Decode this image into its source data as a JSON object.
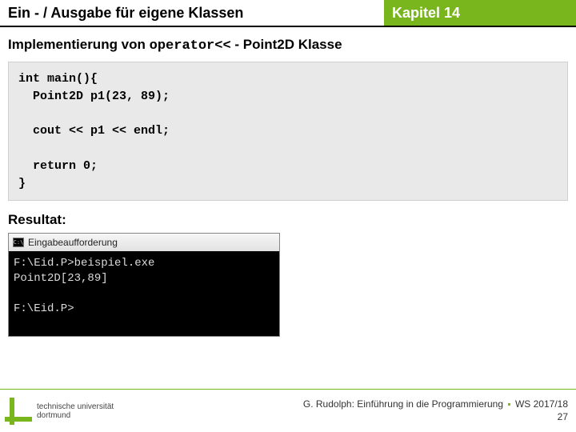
{
  "header": {
    "left": "Ein - / Ausgabe für eigene Klassen",
    "right": "Kapitel 14"
  },
  "subtitle": {
    "prefix": "Implementierung von ",
    "op": "operator<<",
    "suffix": " - Point2D Klasse"
  },
  "code": "int main(){\n  Point2D p1(23, 89);\n\n  cout << p1 << endl;\n\n  return 0;\n}",
  "result_label": "Resultat:",
  "console": {
    "title": "Eingabeaufforderung",
    "icon": "C:\\",
    "body": "F:\\Eid.P>beispiel.exe\nPoint2D[23,89]\n\nF:\\Eid.P>"
  },
  "footer": {
    "uni_line1": "technische universität",
    "uni_line2": "dortmund",
    "credit_prefix": "G. Rudolph: Einführung in die Programmierung ",
    "credit_suffix": " WS 2017/18",
    "page": "27"
  }
}
